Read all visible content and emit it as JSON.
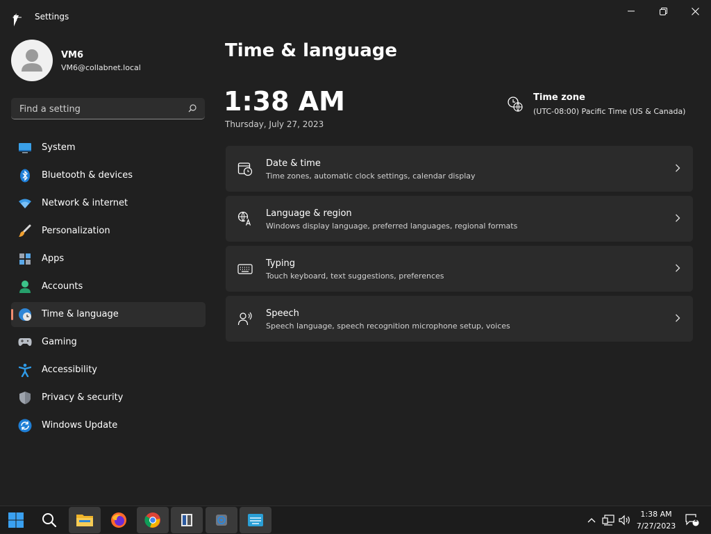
{
  "window": {
    "title": "Settings"
  },
  "profile": {
    "name": "VM6",
    "email": "VM6@collabnet.local"
  },
  "search": {
    "placeholder": "Find a setting",
    "value": ""
  },
  "sidebar": {
    "items": [
      {
        "label": "System",
        "icon": "monitor-icon",
        "selected": false
      },
      {
        "label": "Bluetooth & devices",
        "icon": "bluetooth-icon",
        "selected": false
      },
      {
        "label": "Network & internet",
        "icon": "wifi-icon",
        "selected": false
      },
      {
        "label": "Personalization",
        "icon": "paintbrush-icon",
        "selected": false
      },
      {
        "label": "Apps",
        "icon": "apps-grid-icon",
        "selected": false
      },
      {
        "label": "Accounts",
        "icon": "person-icon",
        "selected": false
      },
      {
        "label": "Time & language",
        "icon": "globe-clock-icon",
        "selected": true
      },
      {
        "label": "Gaming",
        "icon": "gamepad-icon",
        "selected": false
      },
      {
        "label": "Accessibility",
        "icon": "accessibility-icon",
        "selected": false
      },
      {
        "label": "Privacy & security",
        "icon": "shield-icon",
        "selected": false
      },
      {
        "label": "Windows Update",
        "icon": "update-icon",
        "selected": false
      }
    ]
  },
  "main": {
    "title": "Time & language",
    "time": "1:38 AM",
    "date": "Thursday, July 27, 2023",
    "timezone": {
      "label": "Time zone",
      "value": "(UTC-08:00) Pacific Time (US & Canada)"
    },
    "cards": [
      {
        "title": "Date & time",
        "subtitle": "Time zones, automatic clock settings, calendar display",
        "icon": "calendar-clock-icon"
      },
      {
        "title": "Language & region",
        "subtitle": "Windows display language, preferred languages, regional formats",
        "icon": "language-icon"
      },
      {
        "title": "Typing",
        "subtitle": "Touch keyboard, text suggestions, preferences",
        "icon": "keyboard-icon"
      },
      {
        "title": "Speech",
        "subtitle": "Speech language, speech recognition microphone setup, voices",
        "icon": "speech-icon"
      }
    ]
  },
  "taskbar": {
    "time": "1:38 AM",
    "date": "7/27/2023",
    "notification_count": "1"
  },
  "colors": {
    "background": "#202020",
    "card": "#2b2b2b",
    "accent": "#f08c6f"
  }
}
